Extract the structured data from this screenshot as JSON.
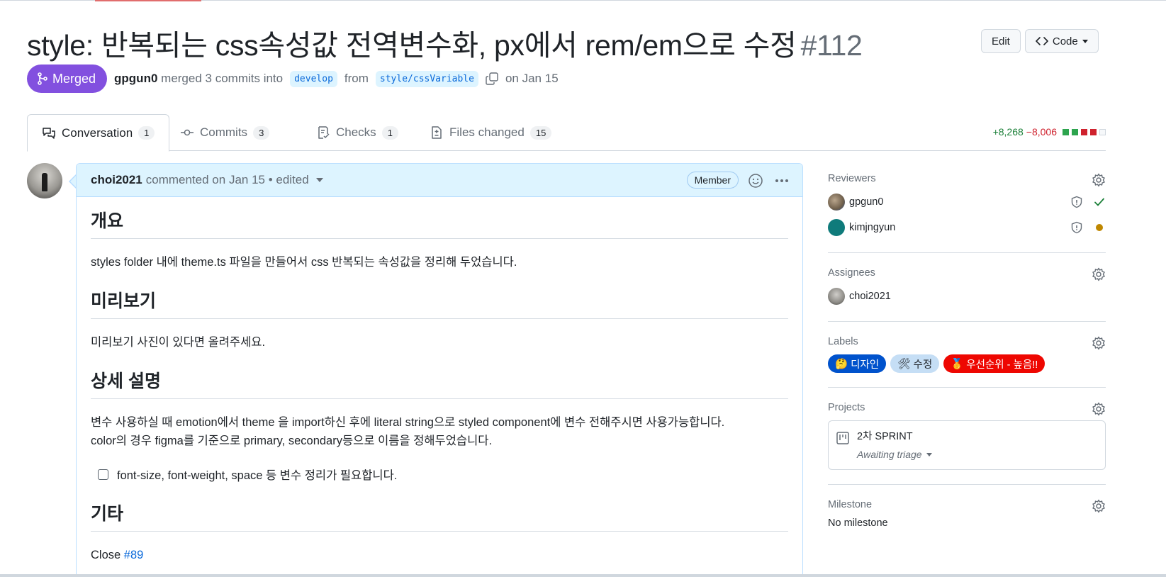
{
  "pr": {
    "title": "style: 반복되는 css속성값 전역변수화, px에서 rem/em으로 수정",
    "number": "#112",
    "state_label": "Merged",
    "author": "gpgun0",
    "merge_text": "merged 3 commits into",
    "base_branch": "develop",
    "from_text": "from",
    "head_branch": "style/cssVariable",
    "date_text": "on Jan 15"
  },
  "header_actions": {
    "edit_label": "Edit",
    "code_label": "Code"
  },
  "tabs": [
    {
      "label": "Conversation",
      "count": "1",
      "icon": "conversation-icon"
    },
    {
      "label": "Commits",
      "count": "3",
      "icon": "commit-icon"
    },
    {
      "label": "Checks",
      "count": "1",
      "icon": "checklist-icon"
    },
    {
      "label": "Files changed",
      "count": "15",
      "icon": "file-diff-icon"
    }
  ],
  "diffstat": {
    "additions": "+8,268",
    "deletions": "−8,006",
    "colors": [
      "#2da44e",
      "#2da44e",
      "#cf222e",
      "#cf222e",
      "#f6f8fa"
    ]
  },
  "comment": {
    "author": "choi2021",
    "meta": "commented on Jan 15 • edited",
    "role_badge": "Member",
    "sections": [
      {
        "heading": "개요",
        "text": "styles folder 내에 theme.ts 파일을 만들어서 css 반복되는 속성값을 정리해 두었습니다."
      },
      {
        "heading": "미리보기",
        "text": "미리보기 사진이 있다면 올려주세요."
      },
      {
        "heading": "상세 설명",
        "text_line1": "변수 사용하실 때 emotion에서 theme 을 import하신 후에 literal string으로 styled component에 변수 전해주시면 사용가능합니다.",
        "text_line2": "color의 경우 figma를 기준으로 primary, secondary등으로 이름을 정해두었습니다.",
        "task": "font-size, font-weight, space 등 변수 정리가 필요합니다."
      },
      {
        "heading": "기타",
        "text_prefix": "Close ",
        "link": "#89"
      }
    ]
  },
  "sidebar": {
    "reviewers": {
      "title": "Reviewers",
      "items": [
        {
          "name": "gpgun0",
          "status": "approved"
        },
        {
          "name": "kimjngyun",
          "status": "pending"
        }
      ]
    },
    "assignees": {
      "title": "Assignees",
      "items": [
        {
          "name": "choi2021"
        }
      ]
    },
    "labels": {
      "title": "Labels",
      "items": [
        {
          "emoji": "🤔",
          "text": "디자인",
          "bg": "#0052cc",
          "fg": "#ffffff"
        },
        {
          "emoji": "🛠",
          "text": "수정",
          "bg": "#c5def5",
          "fg": "#1f2328"
        },
        {
          "emoji": "🥇",
          "text": "우선순위 - 높음!!",
          "bg": "#ee0701",
          "fg": "#ffffff"
        }
      ]
    },
    "projects": {
      "title": "Projects",
      "name": "2차 SPRINT",
      "status": "Awaiting triage"
    },
    "milestone": {
      "title": "Milestone",
      "value": "No milestone"
    }
  }
}
